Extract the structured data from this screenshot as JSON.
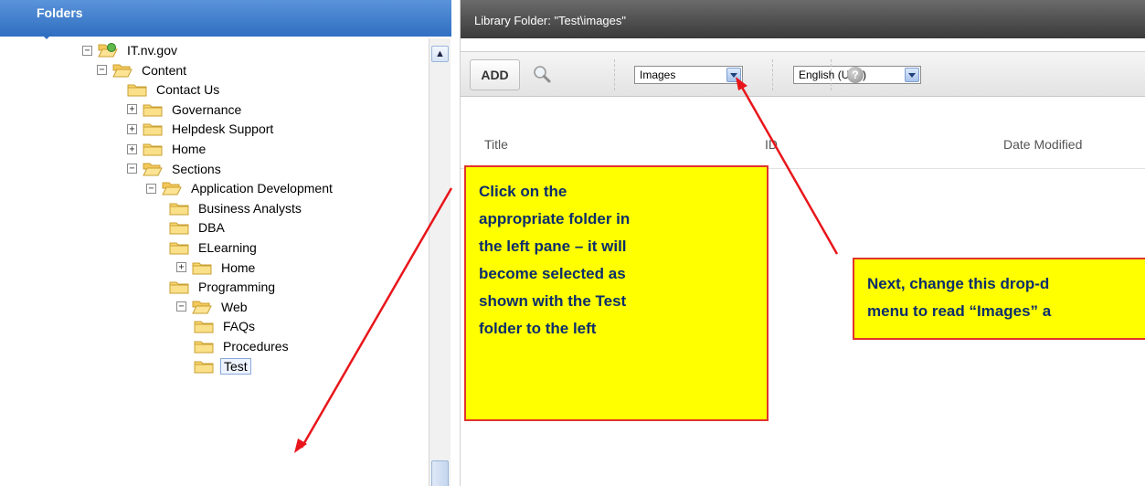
{
  "left_pane": {
    "header": "Folders",
    "tree": [
      {
        "label": "IT.nv.gov",
        "expander": "minus",
        "icon": "site-root-icon"
      },
      {
        "label": "Content",
        "expander": "minus",
        "icon": "folder-open-icon"
      },
      {
        "label": "Contact Us",
        "expander": "none",
        "icon": "folder-icon"
      },
      {
        "label": "Governance",
        "expander": "plus",
        "icon": "folder-icon"
      },
      {
        "label": "Helpdesk Support",
        "expander": "plus",
        "icon": "folder-icon"
      },
      {
        "label": "Home",
        "expander": "plus",
        "icon": "folder-icon"
      },
      {
        "label": "Sections",
        "expander": "minus",
        "icon": "folder-open-icon"
      },
      {
        "label": "Application Development",
        "expander": "minus",
        "icon": "folder-open-icon"
      },
      {
        "label": "Business Analysts",
        "expander": "none",
        "icon": "folder-icon"
      },
      {
        "label": "DBA",
        "expander": "none",
        "icon": "folder-icon"
      },
      {
        "label": "ELearning",
        "expander": "none",
        "icon": "folder-icon"
      },
      {
        "label": "Home",
        "expander": "plus",
        "icon": "folder-icon"
      },
      {
        "label": "Programming",
        "expander": "none",
        "icon": "folder-icon"
      },
      {
        "label": "Web",
        "expander": "minus",
        "icon": "folder-open-icon"
      },
      {
        "label": "FAQs",
        "expander": "none",
        "icon": "folder-icon"
      },
      {
        "label": "Procedures",
        "expander": "none",
        "icon": "folder-icon"
      },
      {
        "label": "Test",
        "expander": "none",
        "icon": "folder-icon",
        "selected": true
      }
    ]
  },
  "right_pane": {
    "title": "Library Folder: \"Test\\images\"",
    "toolbar": {
      "add_label": "ADD",
      "type_select": "Images",
      "language_select": "English (U.S.)"
    },
    "columns": [
      "Title",
      "ID",
      "Date Modified"
    ]
  },
  "callouts": {
    "left": [
      "Click on the",
      "appropriate folder in",
      "the left pane – it will",
      "become selected as",
      "shown with the Test",
      "folder to the left"
    ],
    "right": [
      "Next, change this drop-d",
      "menu to read “Images” a"
    ]
  },
  "colors": {
    "folders_header": "#2f6fc2",
    "title_bar": "#3a3a3a",
    "callout_fill": "#ffff00",
    "callout_border": "#e0352b",
    "callout_text": "#0b2d6b",
    "arrow": "#e8161b"
  }
}
